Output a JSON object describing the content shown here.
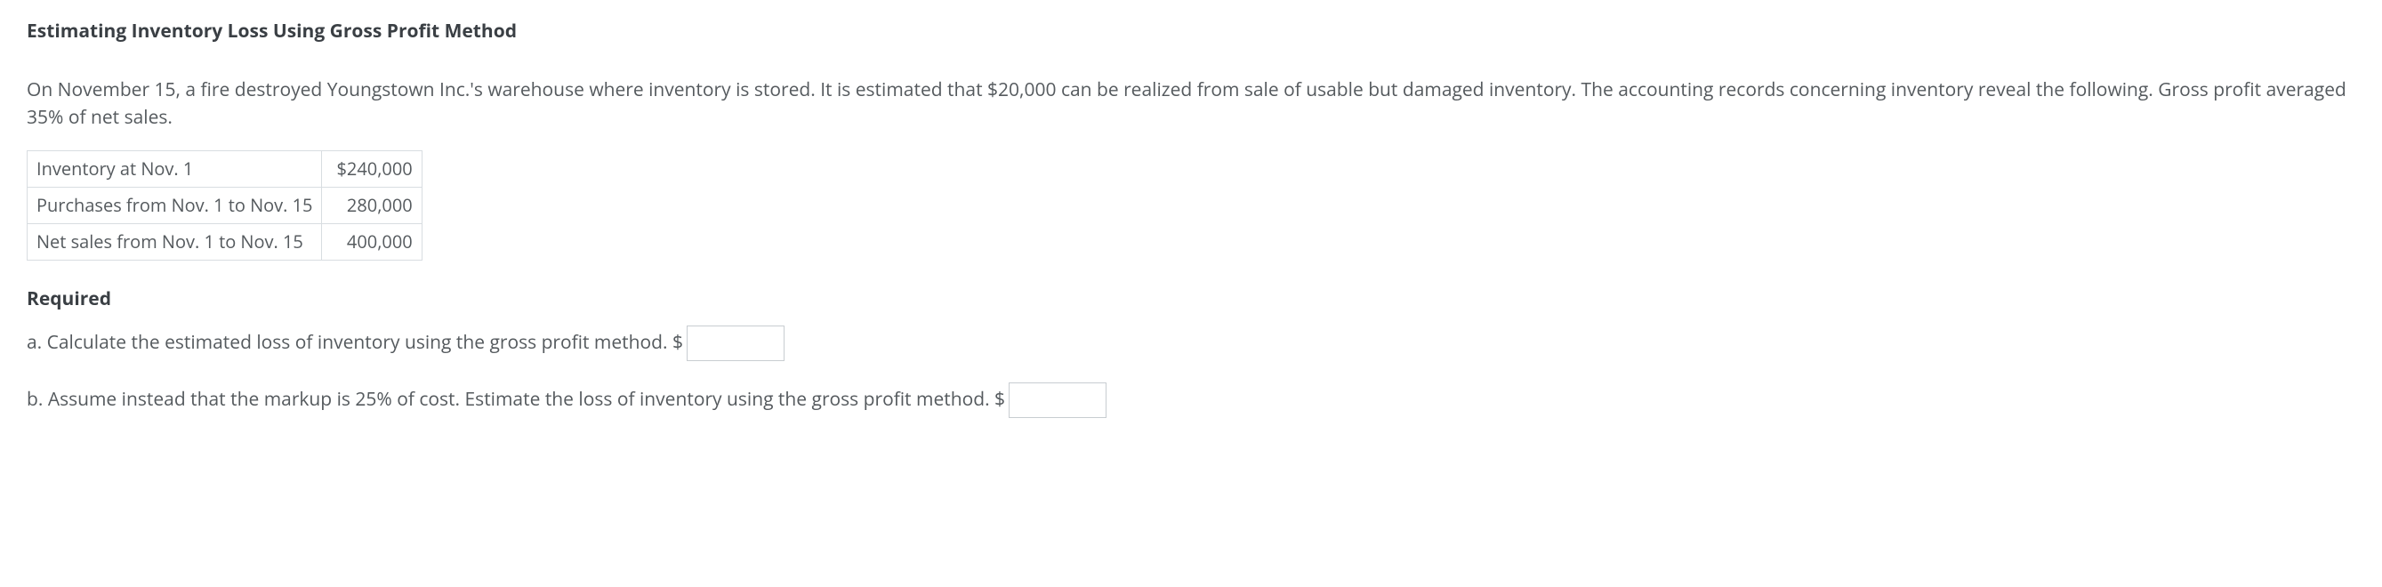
{
  "title": "Estimating Inventory Loss Using Gross Profit Method",
  "intro": "On November 15, a fire destroyed Youngstown Inc.'s warehouse where inventory is stored. It is estimated that $20,000 can be realized from sale of usable but damaged inventory. The accounting records concerning inventory reveal the following. Gross profit averaged 35% of net sales.",
  "table": {
    "rows": [
      {
        "label": "Inventory at Nov. 1",
        "value": "$240,000"
      },
      {
        "label": "Purchases from Nov. 1 to Nov. 15",
        "value": "280,000"
      },
      {
        "label": "Net sales from Nov. 1 to Nov. 15",
        "value": "400,000"
      }
    ]
  },
  "required_heading": "Required",
  "questions": {
    "a": {
      "text": "a. Calculate the estimated loss of inventory using the gross profit method. $",
      "value": ""
    },
    "b": {
      "text": "b. Assume instead that the markup is 25% of cost. Estimate the loss of inventory using the gross profit method. $",
      "value": ""
    }
  }
}
